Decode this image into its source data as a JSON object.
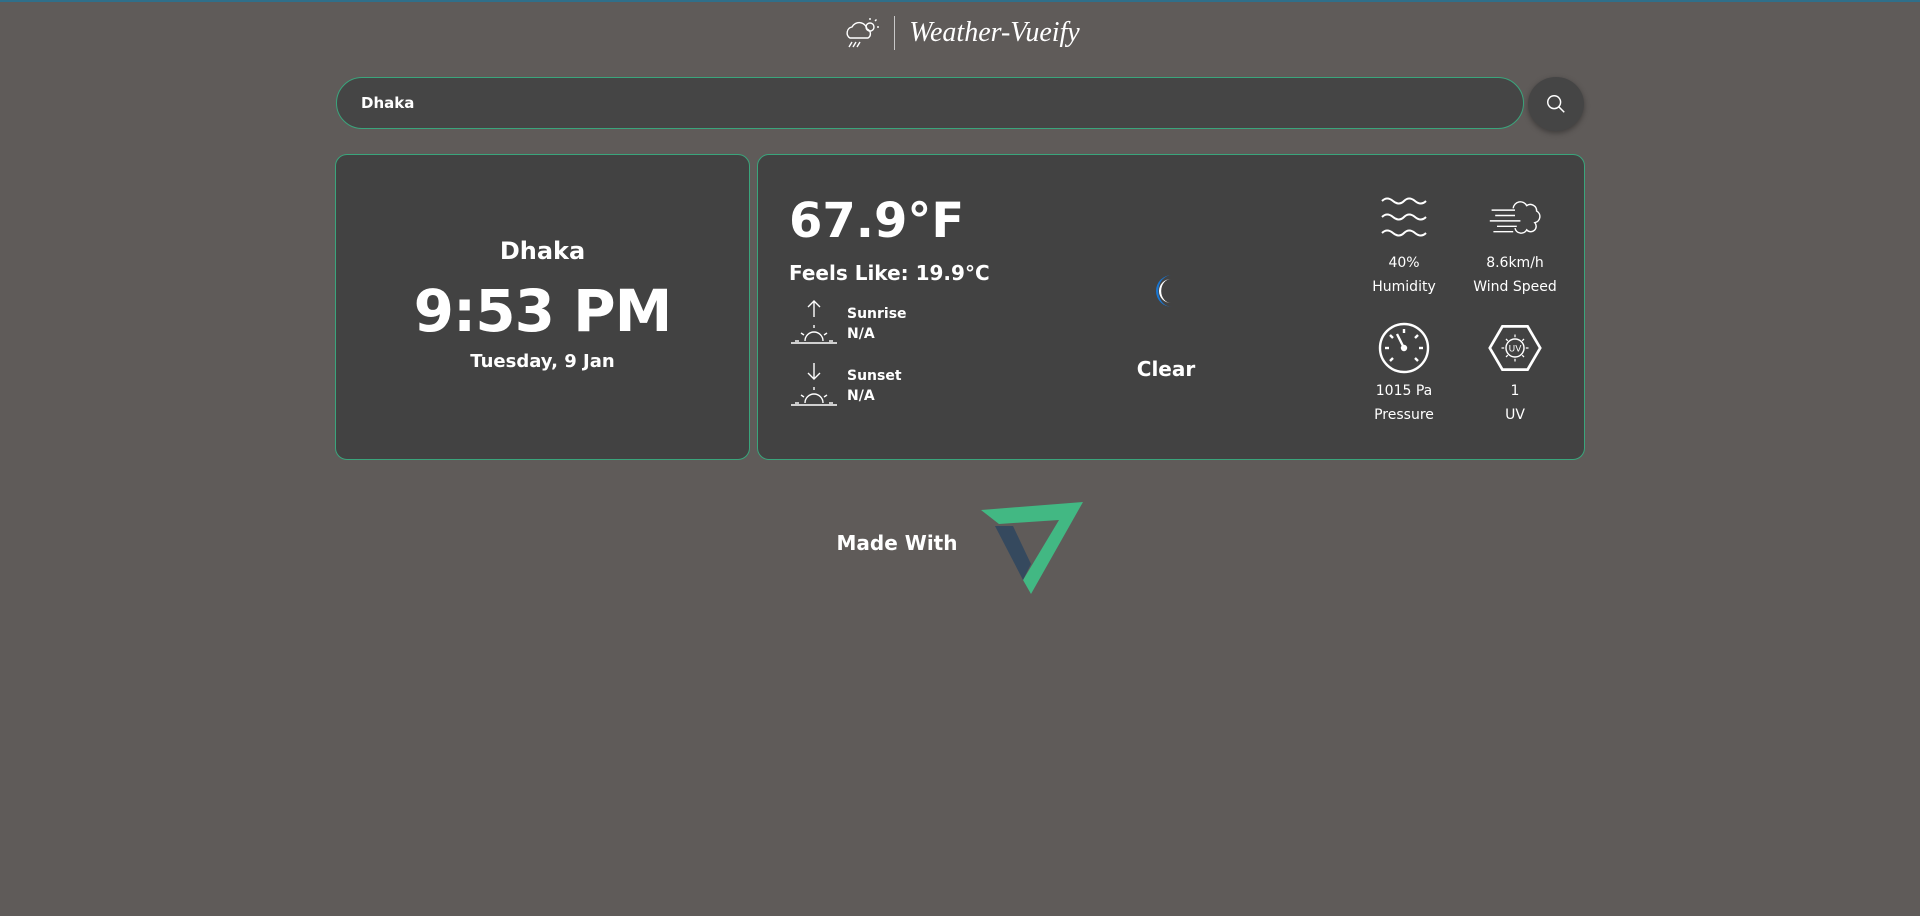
{
  "app": {
    "title": "Weather-Vueify"
  },
  "search": {
    "value": "Dhaka"
  },
  "location": {
    "city": "Dhaka",
    "time": "9:53 PM",
    "date": "Tuesday, 9 Jan"
  },
  "weather": {
    "temperature": "67.9°F",
    "feels_like": "Feels Like: 19.9°C",
    "sunrise_label": "Sunrise",
    "sunrise_value": "N/A",
    "sunset_label": "Sunset",
    "sunset_value": "N/A",
    "condition": "Clear",
    "condition_icon": "moon-icon"
  },
  "stats": {
    "humidity": {
      "value": "40%",
      "label": "Humidity"
    },
    "wind": {
      "value": "8.6km/h",
      "label": "Wind Speed"
    },
    "pressure": {
      "value": "1015 Pa",
      "label": "Pressure"
    },
    "uv": {
      "value": "1",
      "label": "UV"
    }
  },
  "footer": {
    "made_with": "Made With"
  },
  "colors": {
    "background": "#5f5b59",
    "card": "#424242",
    "accent": "#3aa57c",
    "moon": "#1976d2",
    "vuetify_light": "#42b883",
    "vuetify_dark": "#35495e"
  }
}
